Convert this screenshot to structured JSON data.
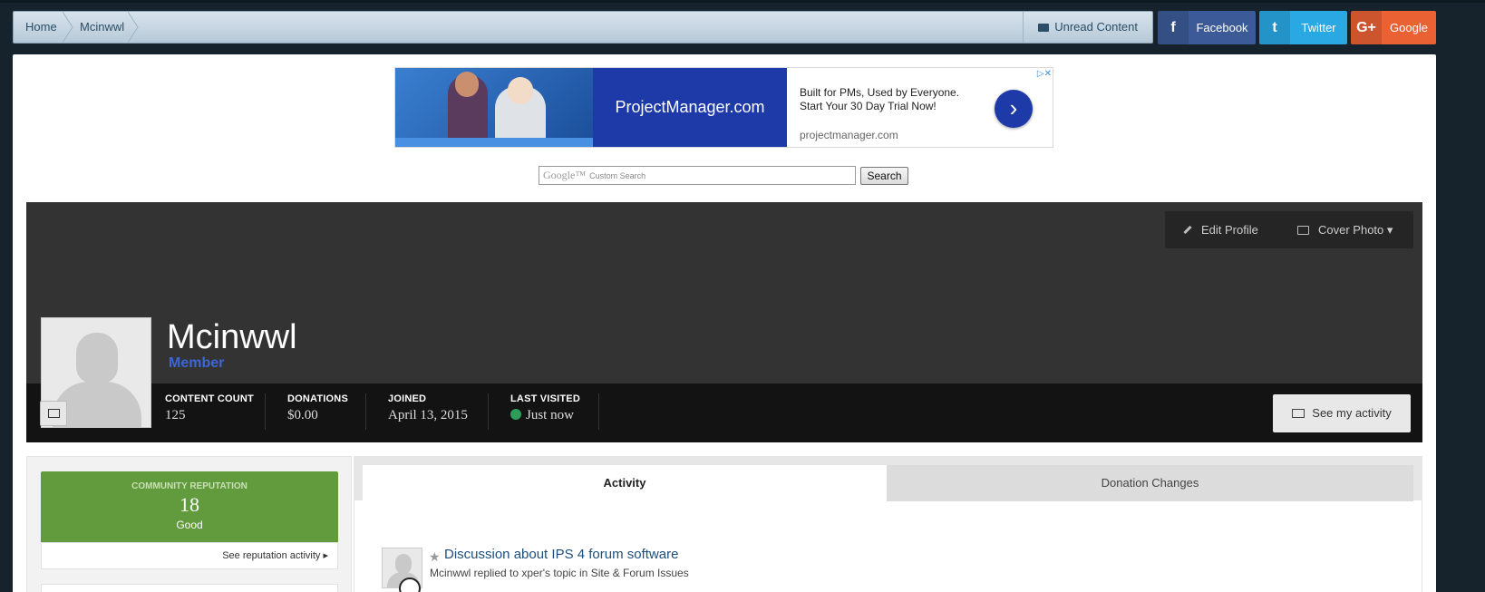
{
  "breadcrumb": {
    "items": [
      "Home",
      "Mcinwwl"
    ],
    "unread_label": "Unread Content"
  },
  "social": {
    "facebook": {
      "icon": "f",
      "label": "Facebook",
      "color": "#3b5a97"
    },
    "twitter": {
      "icon": "t",
      "label": "Twitter",
      "color": "#29a8e3"
    },
    "google": {
      "icon": "G+",
      "label": "Google",
      "color": "#ea6134"
    }
  },
  "ad": {
    "brand": "ProjectManager.com",
    "headline": "Built for PMs, Used by Everyone. Start Your 30 Day Trial Now!",
    "url": "projectmanager.com",
    "arrow": "›",
    "close": "▷✕"
  },
  "search": {
    "brand": "Google™",
    "placeholder": "Custom Search",
    "button": "Search"
  },
  "profile": {
    "edit_label": "Edit Profile",
    "cover_label": "Cover Photo ▾",
    "username": "Mcinwwl",
    "group": "Member",
    "group_color": "#3d67d9",
    "stats": [
      {
        "key": "CONTENT COUNT",
        "value": "125"
      },
      {
        "key": "DONATIONS",
        "value": "$0.00"
      },
      {
        "key": "JOINED",
        "value": "April 13, 2015"
      },
      {
        "key": "LAST VISITED",
        "value": "Just now"
      }
    ],
    "online_color": "#2e9d5a",
    "see_activity": "See my activity"
  },
  "reputation": {
    "title": "COMMUNITY REPUTATION",
    "value": "18",
    "label": "Good",
    "link": "See reputation activity ▸",
    "color": "#629a3e"
  },
  "tabs": [
    {
      "label": "Activity",
      "active": true
    },
    {
      "label": "Donation Changes",
      "active": false
    }
  ],
  "feed": [
    {
      "title": "Discussion about IPS 4 forum software",
      "subtitle": "Mcinwwl replied to xper's topic in Site & Forum Issues"
    }
  ]
}
